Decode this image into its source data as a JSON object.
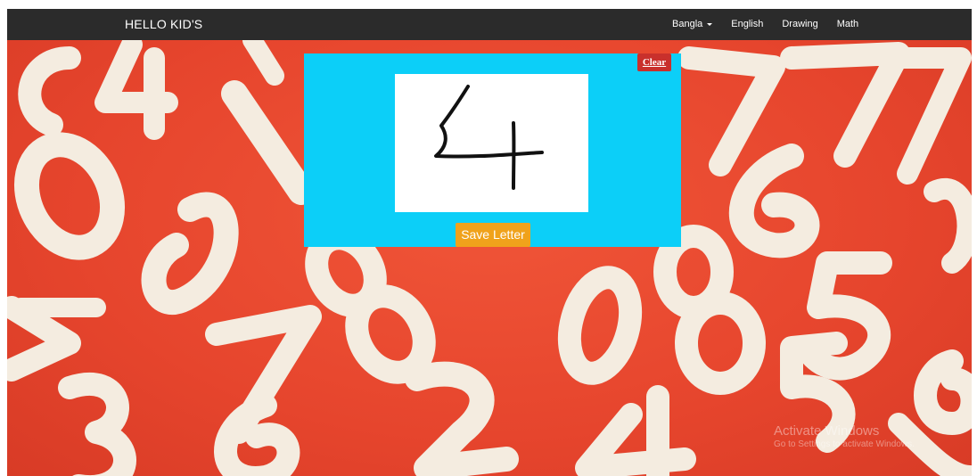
{
  "navbar": {
    "brand": "HELLO KID'S",
    "items": [
      {
        "label": "Bangla",
        "dropdown": true
      },
      {
        "label": "English"
      },
      {
        "label": "Drawing"
      },
      {
        "label": "Math"
      }
    ]
  },
  "drawing_panel": {
    "clear_label": "Clear",
    "save_label": "Save Letter",
    "drawn_character": "4"
  },
  "watermark": {
    "title": "Activate Windows",
    "subtitle": "Go to Settings to activate Windows."
  },
  "colors": {
    "navbar": "#2b2b2b",
    "background": "#e8472f",
    "panel": "#0ccff8",
    "clear_button": "#c9302c",
    "save_button": "#f0a21b",
    "number_pieces": "#f4ece0"
  }
}
